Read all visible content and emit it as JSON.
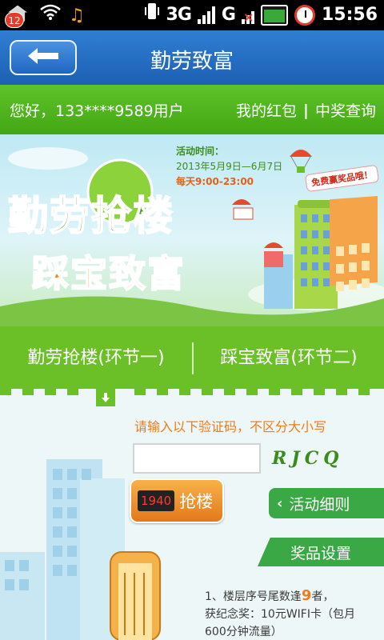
{
  "status_bar": {
    "notification_count": "12",
    "network_label": "3G",
    "network2_label": "G",
    "time": "15:56"
  },
  "titlebar": {
    "back_icon": "left-arrow-icon",
    "title": "勤劳致富"
  },
  "userbar": {
    "greeting": "您好，133****9589用户",
    "link_red_packet": "我的红包",
    "separator": "|",
    "link_prize_query": "中奖查询"
  },
  "banner": {
    "event_time_label": "活动时间：",
    "event_dates": "2013年5月9日—6月7日",
    "event_hours": "每天9:00-23:00",
    "logo_line1": "勤劳抢楼",
    "logo_line2": "踩宝致富",
    "free_prize_tag": "免费赢奖品哦！"
  },
  "tabs": [
    {
      "label": "勤劳抢楼(环节一)",
      "active": true
    },
    {
      "label": "踩宝致富(环节二)",
      "active": false
    }
  ],
  "form": {
    "instruction": "请输入以下验证码，不区分大小写",
    "code_value": "",
    "captcha_text": "RJCQ",
    "counter": "1940",
    "grab_label": "抢楼",
    "rules_label": "活动细则",
    "prize_settings_label": "奖品设置",
    "prize_line1_prefix": "1、楼层序号尾数逢",
    "prize_line1_number": "9",
    "prize_line1_suffix": "者，",
    "prize_line2": "获纪念奖：10元WIFI卡（包月",
    "prize_line3": "600分钟流量）"
  },
  "colors": {
    "title_blue": "#1d5fb3",
    "user_green": "#4fb31a",
    "tab_green": "#6bbf27",
    "button_orange": "#e4781a",
    "rules_green": "#3aa844"
  }
}
